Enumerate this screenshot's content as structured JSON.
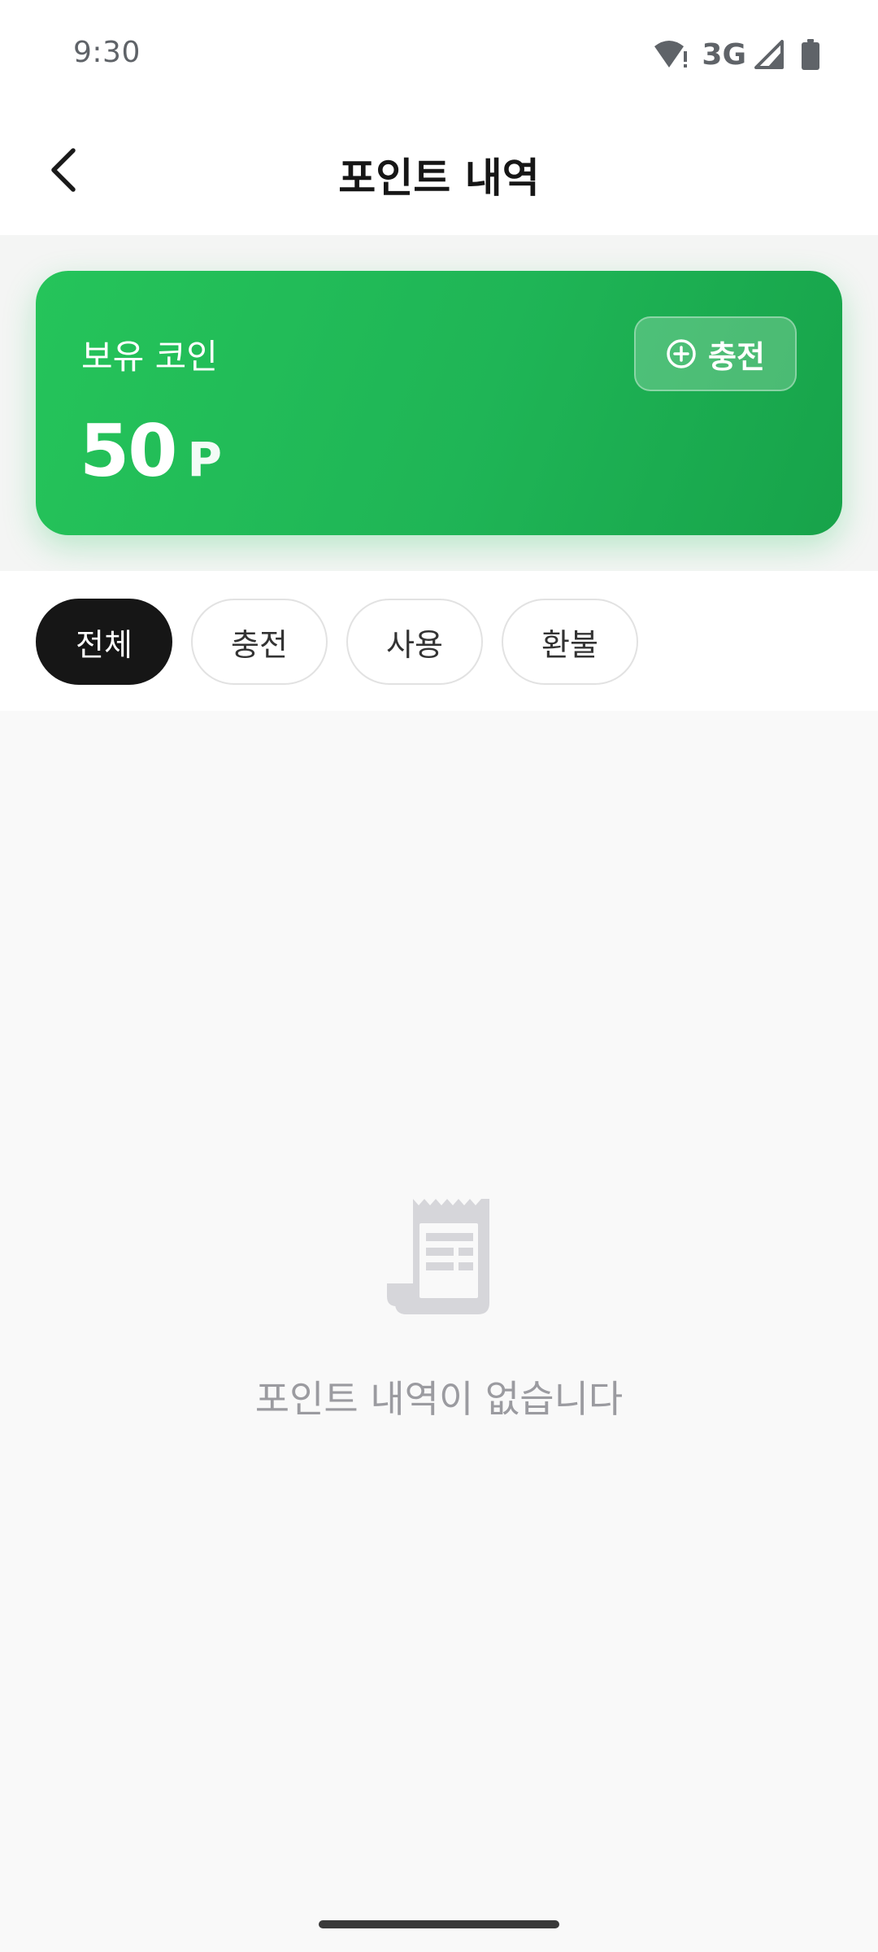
{
  "status_bar": {
    "time": "9:30",
    "network": "3G",
    "icons": [
      "wifi-alert-icon",
      "signal-icon",
      "battery-icon"
    ]
  },
  "header": {
    "title": "포인트 내역",
    "back_icon": "chevron-left-icon"
  },
  "balance_card": {
    "label": "보유 코인",
    "amount": "50",
    "unit": "P",
    "charge_button": {
      "icon": "plus-circle-icon",
      "label": "충전"
    },
    "colors": {
      "gradient_start": "#25c45a",
      "gradient_end": "#17a34a"
    }
  },
  "filters": {
    "items": [
      {
        "label": "전체",
        "active": true
      },
      {
        "label": "충전",
        "active": false
      },
      {
        "label": "사용",
        "active": false
      },
      {
        "label": "환불",
        "active": false
      }
    ]
  },
  "empty_state": {
    "icon": "receipt-icon",
    "message": "포인트 내역이 없습니다"
  }
}
